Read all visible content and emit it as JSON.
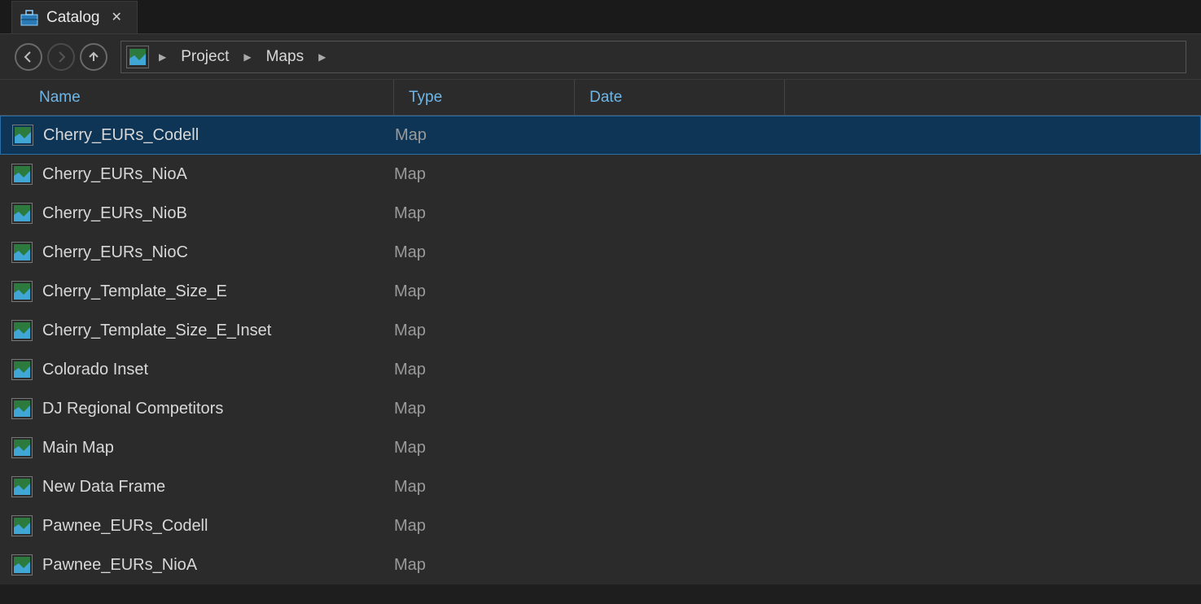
{
  "tab": {
    "title": "Catalog"
  },
  "breadcrumb": {
    "items": [
      "Project",
      "Maps"
    ]
  },
  "columns": {
    "name": "Name",
    "type": "Type",
    "date": "Date"
  },
  "rows": [
    {
      "name": "Cherry_EURs_Codell",
      "type": "Map",
      "date": "",
      "selected": true
    },
    {
      "name": "Cherry_EURs_NioA",
      "type": "Map",
      "date": "",
      "selected": false
    },
    {
      "name": "Cherry_EURs_NioB",
      "type": "Map",
      "date": "",
      "selected": false
    },
    {
      "name": "Cherry_EURs_NioC",
      "type": "Map",
      "date": "",
      "selected": false
    },
    {
      "name": "Cherry_Template_Size_E",
      "type": "Map",
      "date": "",
      "selected": false
    },
    {
      "name": "Cherry_Template_Size_E_Inset",
      "type": "Map",
      "date": "",
      "selected": false
    },
    {
      "name": "Colorado Inset",
      "type": "Map",
      "date": "",
      "selected": false
    },
    {
      "name": "DJ Regional Competitors",
      "type": "Map",
      "date": "",
      "selected": false
    },
    {
      "name": "Main Map",
      "type": "Map",
      "date": "",
      "selected": false
    },
    {
      "name": "New Data Frame",
      "type": "Map",
      "date": "",
      "selected": false
    },
    {
      "name": "Pawnee_EURs_Codell",
      "type": "Map",
      "date": "",
      "selected": false
    },
    {
      "name": "Pawnee_EURs_NioA",
      "type": "Map",
      "date": "",
      "selected": false
    }
  ]
}
